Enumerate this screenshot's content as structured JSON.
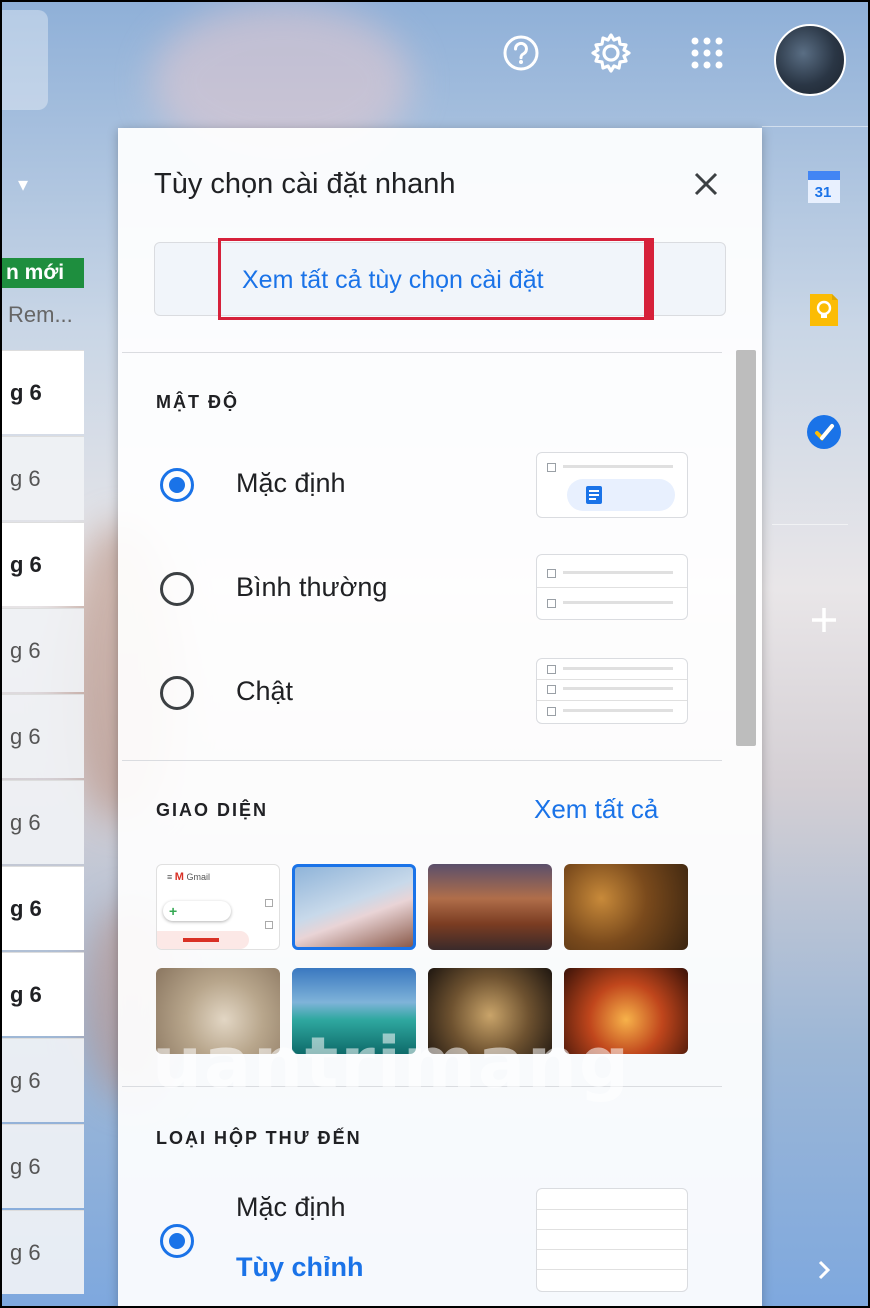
{
  "colors": {
    "accent": "#1a73e8",
    "highlight_box": "#d6213a",
    "label_green": "#1e8e3e"
  },
  "topbar": {
    "icons": [
      "help-icon",
      "settings-gear-icon",
      "apps-grid-icon"
    ],
    "avatar": "account-avatar"
  },
  "inbox_list": {
    "tag_label": "n mới",
    "preview_text": "Rem...",
    "rows": [
      {
        "date": "g 6",
        "unread": true
      },
      {
        "date": "g 6",
        "unread": false
      },
      {
        "date": "g 6",
        "unread": true
      },
      {
        "date": "g 6",
        "unread": false
      },
      {
        "date": "g 6",
        "unread": false
      },
      {
        "date": "g 6",
        "unread": false
      },
      {
        "date": "g 6",
        "unread": true
      },
      {
        "date": "g 6",
        "unread": true
      },
      {
        "date": "g 6",
        "unread": false
      },
      {
        "date": "g 6",
        "unread": false
      },
      {
        "date": "g 6",
        "unread": false
      }
    ]
  },
  "side_panel": {
    "calendar_day": "31",
    "icons": [
      "calendar-icon",
      "keep-icon",
      "tasks-icon",
      "add-icon",
      "expand-chevron-icon"
    ]
  },
  "quick_settings": {
    "title": "Tùy chọn cài đặt nhanh",
    "see_all_settings": "Xem tất cả tùy chọn cài đặt",
    "density": {
      "heading": "MẬT ĐỘ",
      "options": [
        {
          "label": "Mặc định",
          "selected": true
        },
        {
          "label": "Bình thường",
          "selected": false
        },
        {
          "label": "Chật",
          "selected": false
        }
      ]
    },
    "theme": {
      "heading": "GIAO DIỆN",
      "view_all": "Xem tất cả",
      "thumbnails": [
        "default-gmail",
        "cherry-blossom",
        "canyon",
        "autumn-leaves",
        "sand-wheel",
        "lake",
        "chess",
        "red-canyon"
      ],
      "selected_index": 1,
      "default_thumb_text": "Gmail"
    },
    "inbox_type": {
      "heading": "LOẠI HỘP THƯ ĐẾN",
      "option_label": "Mặc định",
      "customize": "Tùy chỉnh"
    }
  },
  "watermark": "uantrimang"
}
